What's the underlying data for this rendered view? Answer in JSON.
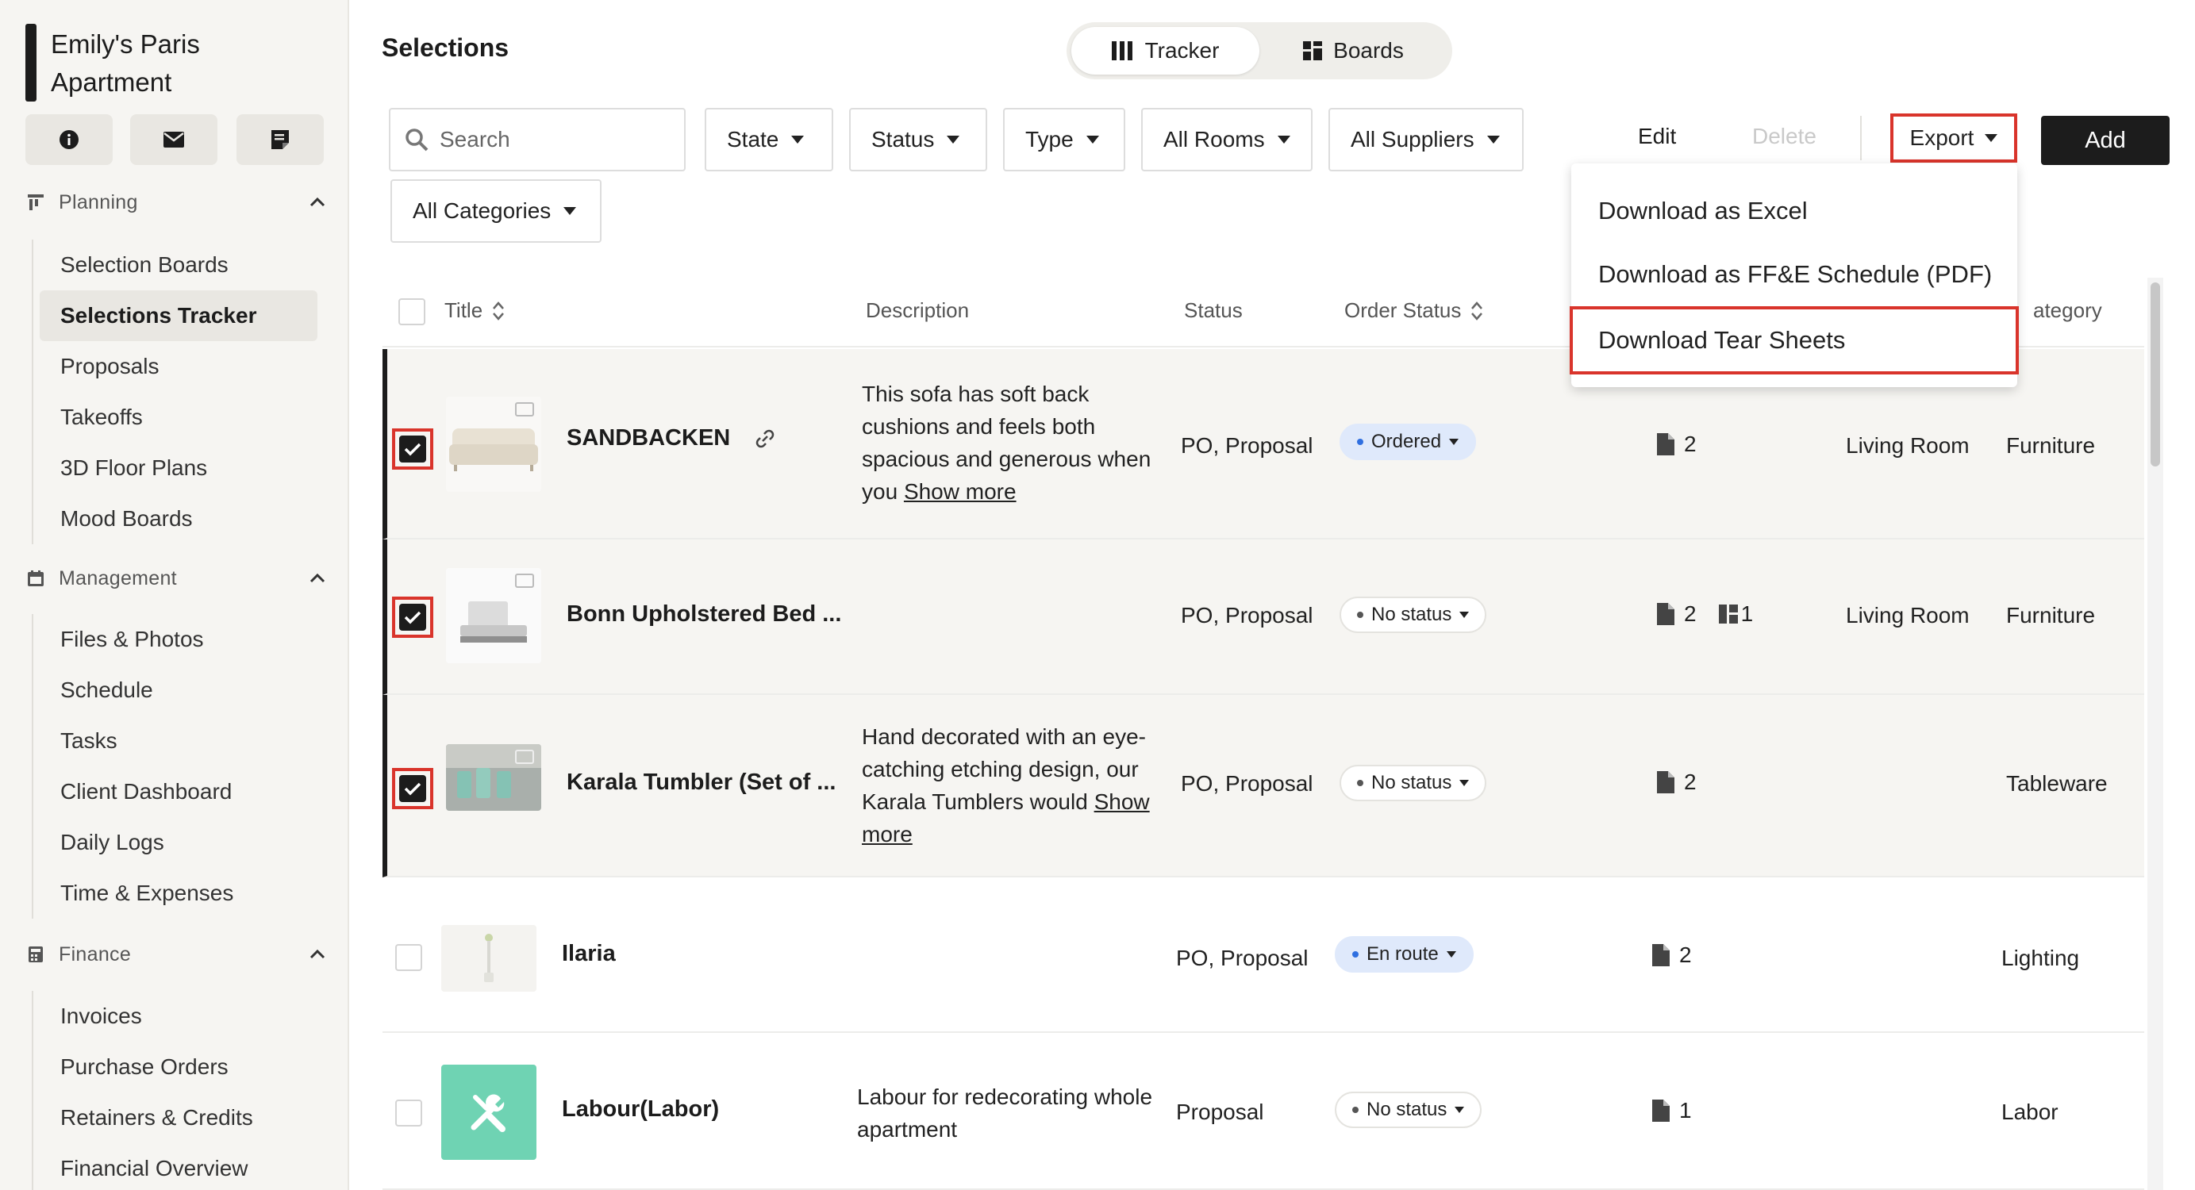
{
  "project": {
    "name": "Emily's Paris Apartment"
  },
  "sidebar": {
    "planning": {
      "label": "Planning",
      "items": [
        "Selection Boards",
        "Selections Tracker",
        "Proposals",
        "Takeoffs",
        "3D Floor Plans",
        "Mood Boards"
      ]
    },
    "management": {
      "label": "Management",
      "items": [
        "Files & Photos",
        "Schedule",
        "Tasks",
        "Client Dashboard",
        "Daily Logs",
        "Time & Expenses"
      ]
    },
    "finance": {
      "label": "Finance",
      "items": [
        "Invoices",
        "Purchase Orders",
        "Retainers & Credits",
        "Financial Overview"
      ]
    }
  },
  "header": {
    "title": "Selections",
    "view_tabs": [
      "Tracker",
      "Boards"
    ]
  },
  "toolbar": {
    "search_placeholder": "Search",
    "filters": [
      "State",
      "Status",
      "Type",
      "All Rooms",
      "All Suppliers",
      "All Categories"
    ],
    "edit_label": "Edit",
    "delete_label": "Delete",
    "export_label": "Export",
    "add_label": "Add"
  },
  "export_menu": [
    "Download as Excel",
    "Download as FF&E Schedule (PDF)",
    "Download Tear Sheets"
  ],
  "table": {
    "columns": {
      "title": "Title",
      "description": "Description",
      "status": "Status",
      "order_status": "Order Status",
      "category": "ategory"
    },
    "rows": [
      {
        "title": "SANDBACKEN",
        "desc": "This sofa has soft back cushions and feels both spacious and generous when you",
        "more": "Show more",
        "status": "PO, Proposal",
        "order_status": "Ordered",
        "files": "2",
        "boards": "",
        "room": "Living Room",
        "category": "Furniture"
      },
      {
        "title": "Bonn Upholstered Bed ...",
        "desc": "",
        "more": "",
        "status": "PO, Proposal",
        "order_status": "No status",
        "files": "2",
        "boards": "1",
        "room": "Living Room",
        "category": "Furniture"
      },
      {
        "title": "Karala Tumbler (Set of ...",
        "desc": "Hand decorated with an eye-catching etching design, our Karala Tumblers would",
        "more": "Show more",
        "status": "PO, Proposal",
        "order_status": "No status",
        "files": "2",
        "boards": "",
        "room": "",
        "category": "Tableware"
      },
      {
        "title": "Ilaria",
        "desc": "",
        "more": "",
        "status": "PO, Proposal",
        "order_status": "En route",
        "files": "2",
        "boards": "",
        "room": "",
        "category": "Lighting"
      },
      {
        "title": "Labour(Labor)",
        "desc": "Labour for redecorating whole apartment",
        "more": "",
        "status": "Proposal",
        "order_status": "No status",
        "files": "1",
        "boards": "",
        "room": "",
        "category": "Labor"
      }
    ]
  },
  "colors": {
    "highlight": "#d9342b",
    "ordered_pill": "#dfe9fb",
    "labor_thumb": "#6fd3b3"
  }
}
